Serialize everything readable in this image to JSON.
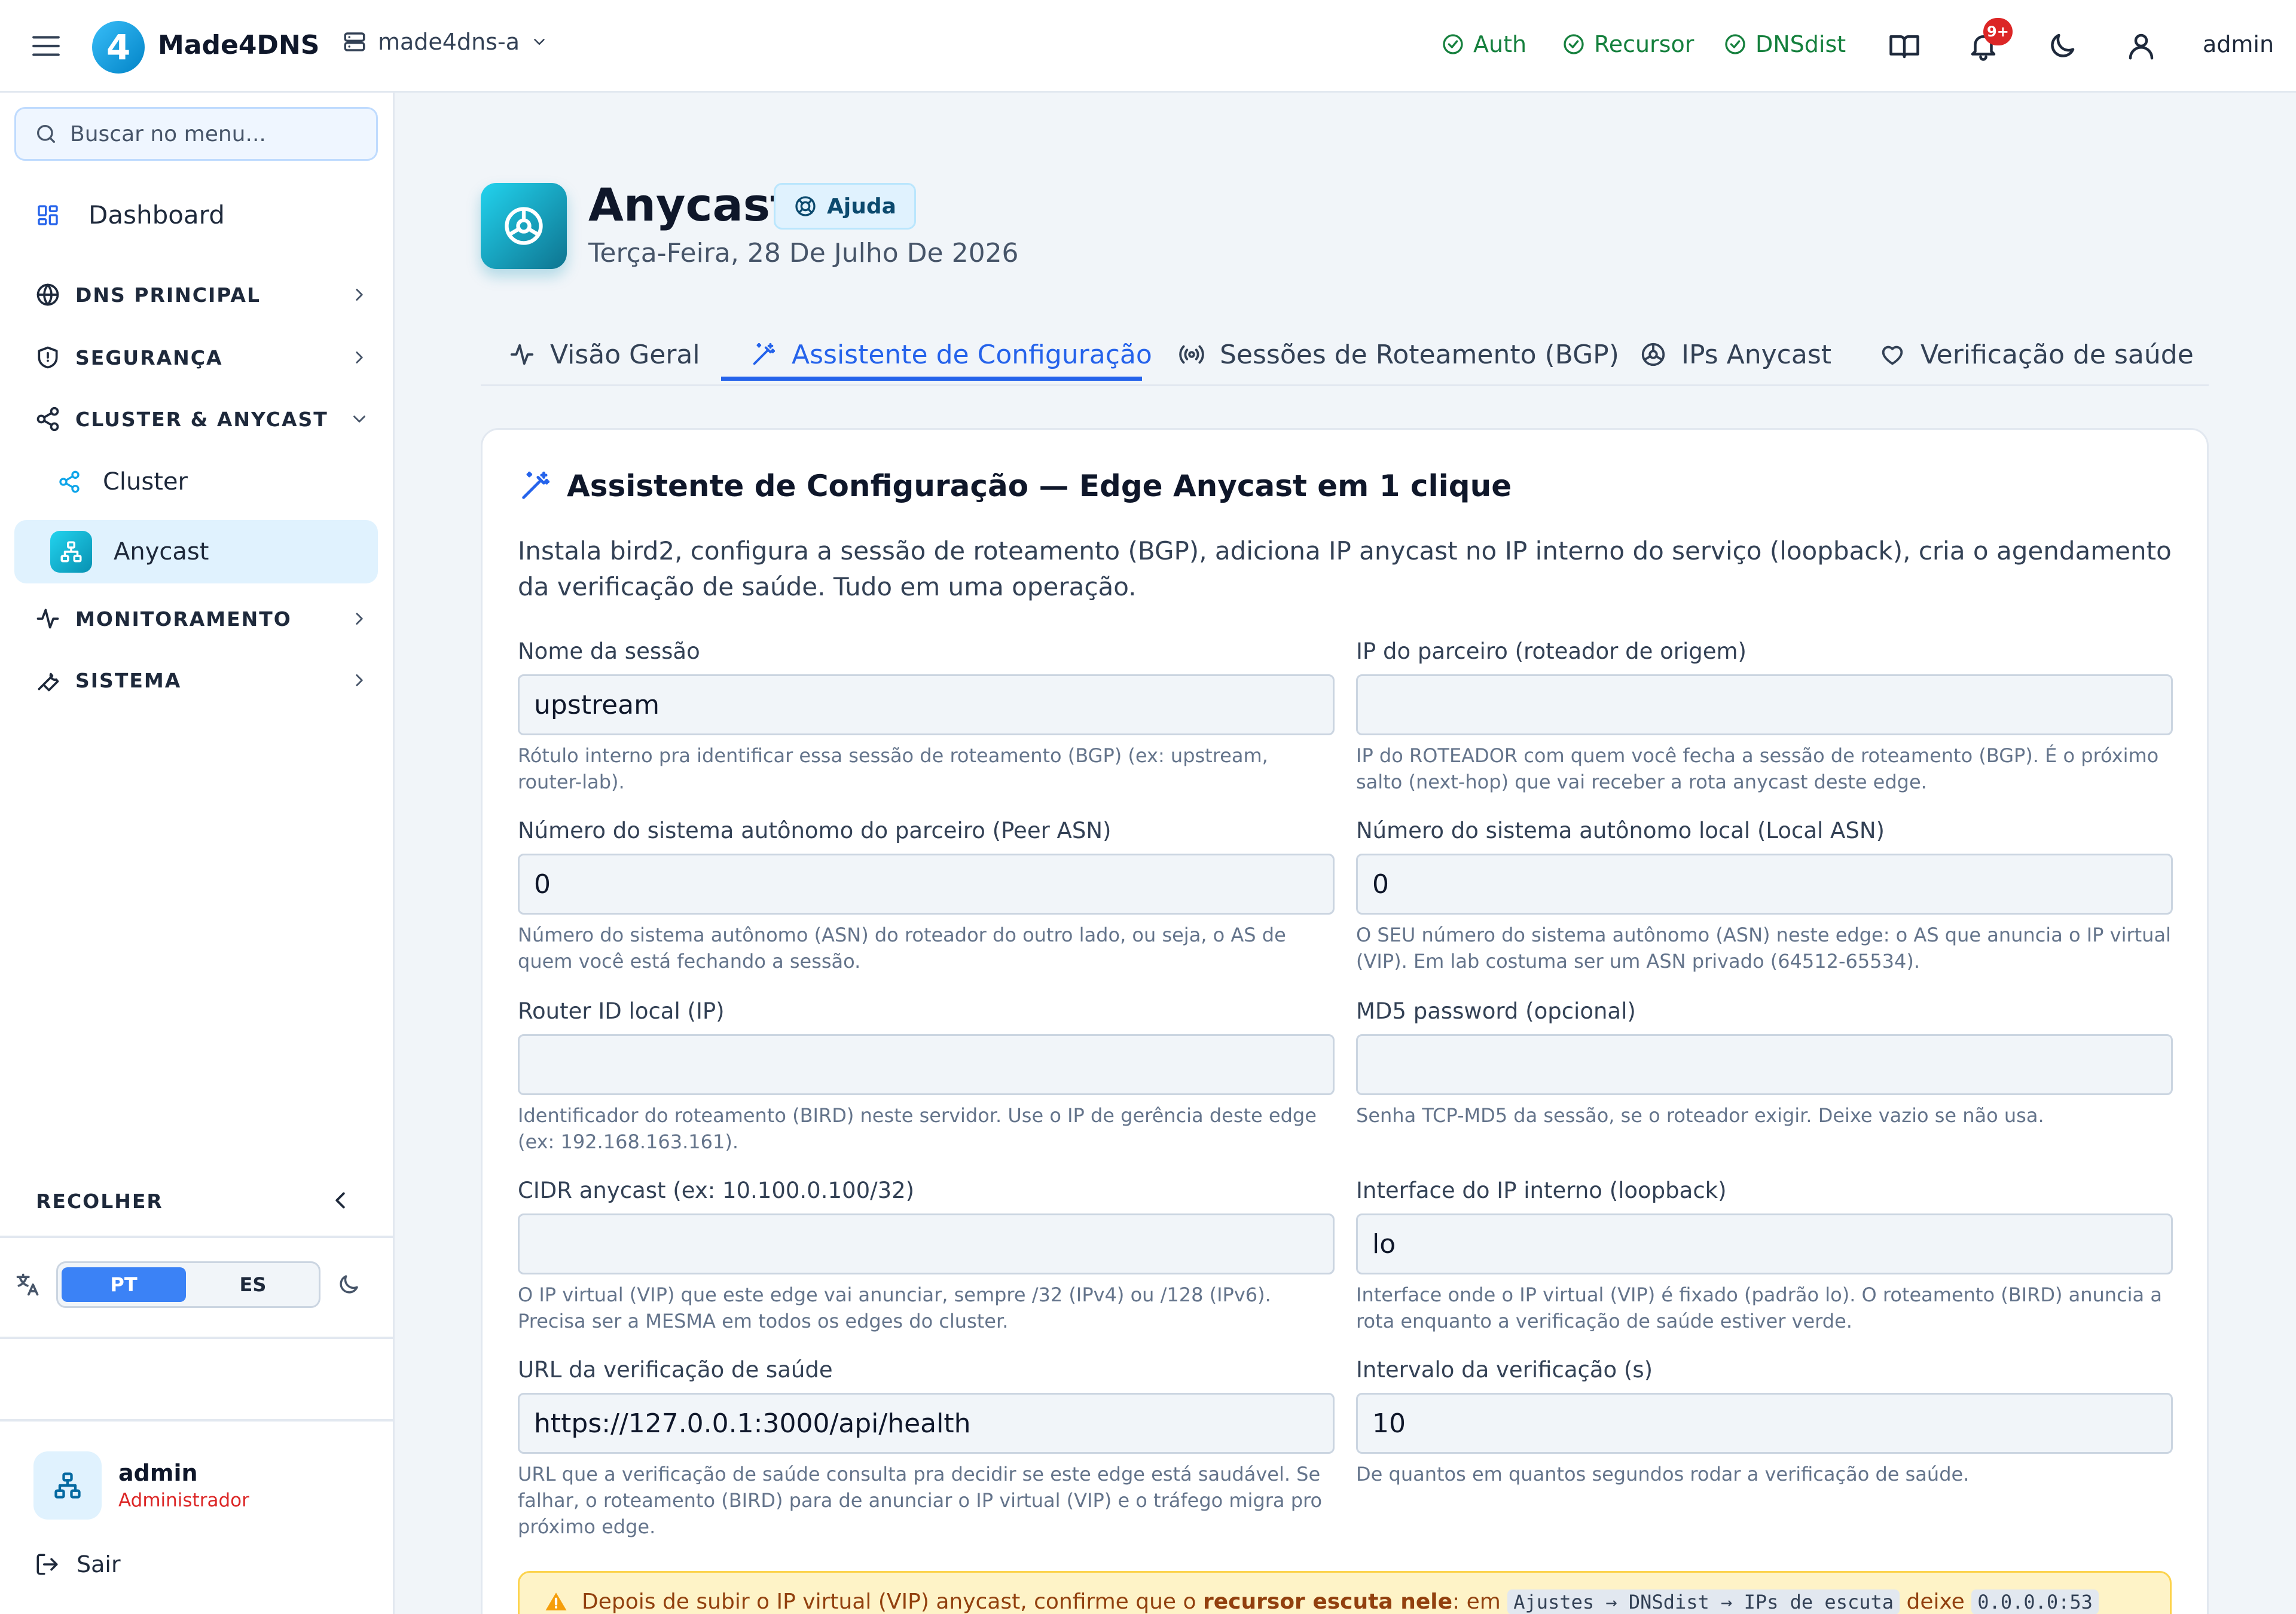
{
  "topbar": {
    "brand": "Made4DNS",
    "server": "made4dns-a",
    "services": [
      "Auth",
      "Recursor",
      "DNSdist"
    ],
    "notif_count": "9+",
    "user": "admin"
  },
  "sidebar": {
    "search_placeholder": "Buscar no menu...",
    "dashboard": "Dashboard",
    "groups": [
      "DNS PRINCIPAL",
      "SEGURANÇA",
      "CLUSTER & ANYCAST",
      "MONITORAMENTO",
      "SISTEMA"
    ],
    "sub_items": [
      "Cluster",
      "Anycast"
    ],
    "collapse": "RECOLHER",
    "languages": [
      "PT",
      "ES"
    ],
    "user_name": "admin",
    "user_role": "Administrador",
    "logout": "Sair"
  },
  "page": {
    "title": "Anycast",
    "help": "Ajuda",
    "date": "Terça-Feira, 28 De Julho De 2026"
  },
  "tabs": [
    "Visão Geral",
    "Assistente de Configuração",
    "Sessões de Roteamento (BGP)",
    "IPs Anycast",
    "Verificação de saúde"
  ],
  "wizard": {
    "title": "Assistente de Configuração — Edge Anycast em 1 clique",
    "description": "Instala bird2, configura a sessão de roteamento (BGP), adiciona IP anycast no IP interno do serviço (loopback), cria o agendamento da verificação de saúde. Tudo em uma operação.",
    "fields": [
      {
        "label": "Nome da sessão",
        "value": "upstream",
        "help": "Rótulo interno pra identificar essa sessão de roteamento (BGP) (ex: upstream, router-lab)."
      },
      {
        "label": "IP do parceiro (roteador de origem)",
        "value": "",
        "help": "IP do ROTEADOR com quem você fecha a sessão de roteamento (BGP). É o próximo salto (next-hop) que vai receber a rota anycast deste edge."
      },
      {
        "label": "Número do sistema autônomo do parceiro (Peer ASN)",
        "value": "0",
        "help": "Número do sistema autônomo (ASN) do roteador do outro lado, ou seja, o AS de quem você está fechando a sessão."
      },
      {
        "label": "Número do sistema autônomo local (Local ASN)",
        "value": "0",
        "help": "O SEU número do sistema autônomo (ASN) neste edge: o AS que anuncia o IP virtual (VIP). Em lab costuma ser um ASN privado (64512-65534)."
      },
      {
        "label": "Router ID local (IP)",
        "value": "",
        "help": "Identificador do roteamento (BIRD) neste servidor. Use o IP de gerência deste edge (ex: 192.168.163.161)."
      },
      {
        "label": "MD5 password (opcional)",
        "value": "",
        "help": "Senha TCP-MD5 da sessão, se o roteador exigir. Deixe vazio se não usa."
      },
      {
        "label": "CIDR anycast (ex: 10.100.0.100/32)",
        "value": "",
        "help": "O IP virtual (VIP) que este edge vai anunciar, sempre /32 (IPv4) ou /128 (IPv6). Precisa ser a MESMA em todos os edges do cluster."
      },
      {
        "label": "Interface do IP interno (loopback)",
        "value": "lo",
        "help": "Interface onde o IP virtual (VIP) é fixado (padrão lo). O roteamento (BIRD) anuncia a rota enquanto a verificação de saúde estiver verde."
      },
      {
        "label": "URL da verificação de saúde",
        "value": "https://127.0.0.1:3000/api/health",
        "help": "URL que a verificação de saúde consulta pra decidir se este edge está saudável. Se falhar, o roteamento (BIRD) para de anunciar o IP virtual (VIP) e o tráfego migra pro próximo edge."
      },
      {
        "label": "Intervalo da verificação (s)",
        "value": "10",
        "help": "De quantos em quantos segundos rodar a verificação de saúde."
      }
    ],
    "alert": {
      "prefix": "Depois de subir o IP virtual (VIP) anycast, confirme que o",
      "bold": "recursor escuta nele",
      "mid": ": em",
      "code1": "Ajustes → DNSdist → IPs de escuta",
      "mid2": "deixe",
      "code2": "0.0.0.0:53"
    }
  }
}
